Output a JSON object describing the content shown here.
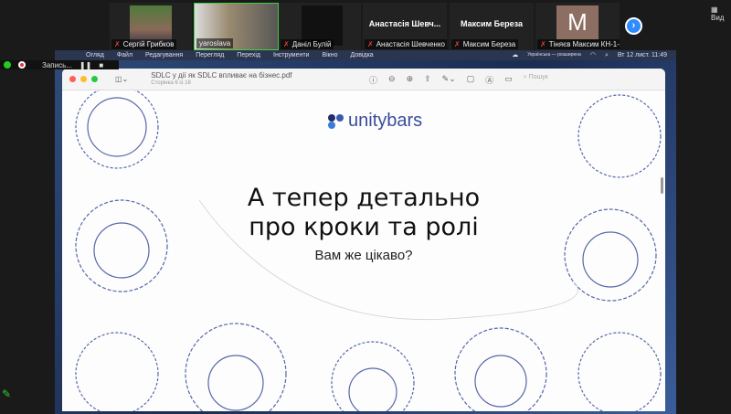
{
  "participants": [
    {
      "name": "Сергій Грибков",
      "muted": true,
      "video": true
    },
    {
      "name": "yaroslava",
      "muted": false,
      "video": true
    },
    {
      "name": "Даніл Булій",
      "muted": true,
      "video": false
    },
    {
      "name": "Анастасія Шевченко",
      "display": "Анастасія Шевч...",
      "muted": true
    },
    {
      "name": "Максим Береза",
      "display": "Максим Береза",
      "muted": true
    },
    {
      "name": "Тіняєв Максим КН-1-...",
      "avatar_letter": "M",
      "muted": true
    }
  ],
  "view_label": "Вид",
  "recording": {
    "label": "Запись..."
  },
  "mac_menu": [
    "Огляд",
    "Файл",
    "Редагування",
    "Перегляд",
    "Перехід",
    "Інструменти",
    "Вікно",
    "Довідка"
  ],
  "mac_status": {
    "input_source": "Українська — розширена",
    "datetime": "Вт 12 лист.  11:49"
  },
  "preview": {
    "filename": "SDLC у дії як SDLC впливає на бізнес.pdf",
    "page_info": "Сторінка 6 із 18",
    "search_placeholder": "Пошук"
  },
  "slide": {
    "logo": "unitybars",
    "title_line1": "А тепер детально",
    "title_line2": "про кроки та ролі",
    "subtitle": "Вам же цікаво?"
  },
  "colors": {
    "accent": "#2d8cff",
    "doodle": "#3a4d9a"
  }
}
